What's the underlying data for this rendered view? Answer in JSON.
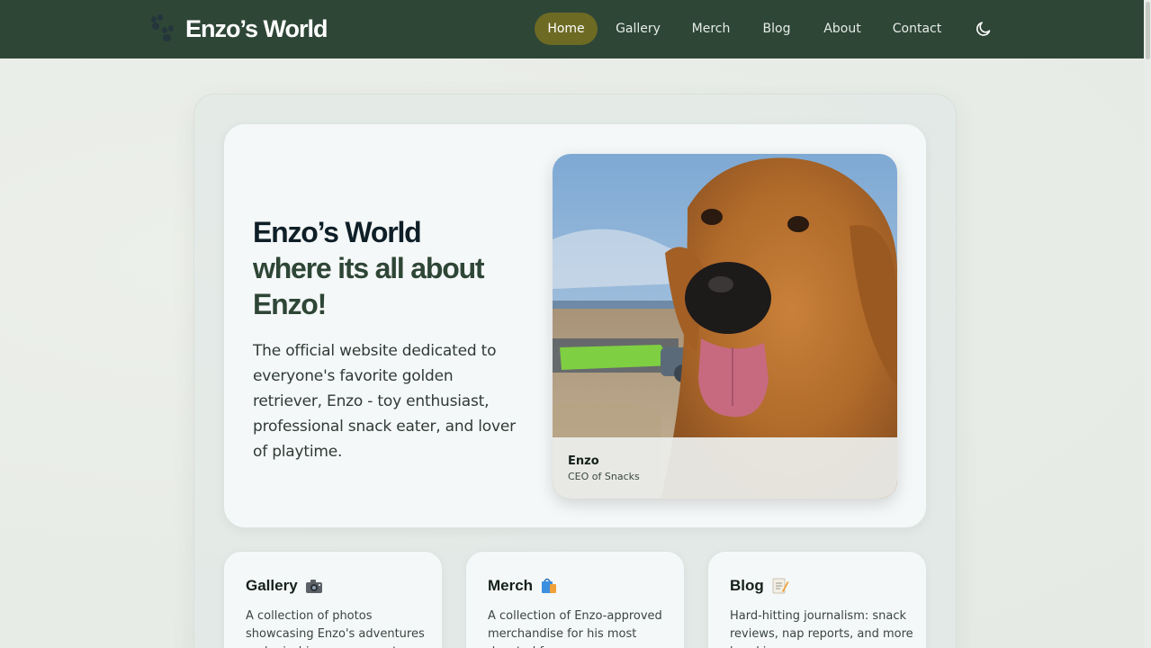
{
  "nav": {
    "brand": "Enzo’s World",
    "links": [
      {
        "label": "Home",
        "active": true
      },
      {
        "label": "Gallery"
      },
      {
        "label": "Merch"
      },
      {
        "label": "Blog"
      },
      {
        "label": "About"
      },
      {
        "label": "Contact"
      }
    ],
    "theme_icon": "moon-icon"
  },
  "hero": {
    "title_line1": "Enzo’s World",
    "title_line2": "where its all about",
    "title_line3": "Enzo!",
    "description": "The official website dedicated to everyone's favorite golden retriever, Enzo - toy enthusiast, professional snack eater, and lover of playtime.",
    "photo": {
      "caption_name": "Enzo",
      "caption_role": "CEO of Snacks"
    }
  },
  "cards": [
    {
      "title": "Gallery",
      "icon": "camera-icon",
      "description": "A collection of photos showcasing Enzo's adventures and mischievous moments"
    },
    {
      "title": "Merch",
      "icon": "shopping-bag-icon",
      "description": "A collection of Enzo-approved merchandise for his most devoted fans"
    },
    {
      "title": "Blog",
      "icon": "memo-icon",
      "description": "Hard-hitting journalism: snack reviews, nap reports, and more breaking news"
    }
  ],
  "colors": {
    "nav_bg": "#2e4636",
    "active_link_bg": "#6d6a24",
    "title_dark": "#0f1f27",
    "title_green": "#2e4636"
  }
}
